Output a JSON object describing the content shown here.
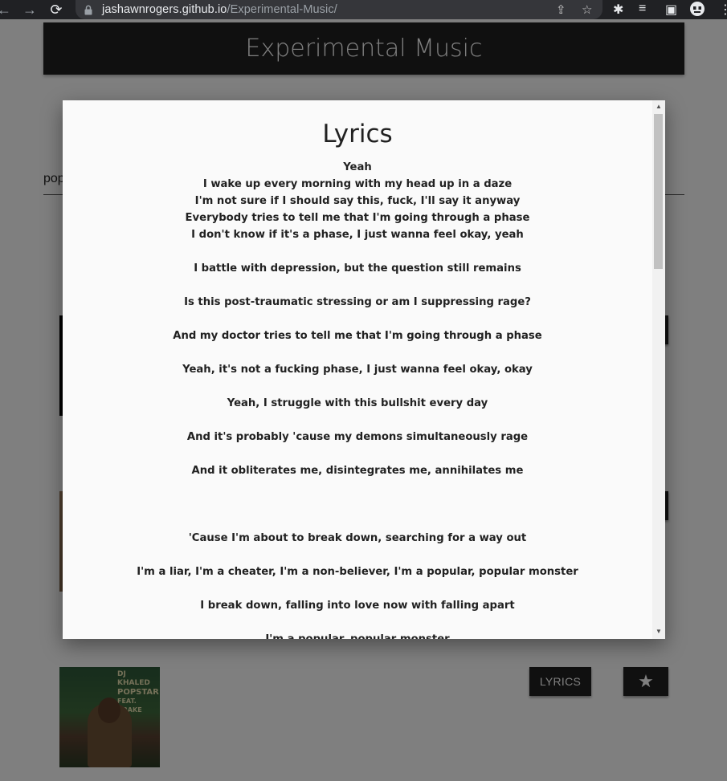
{
  "browser": {
    "url_host": "jashawnrogers.github.io",
    "url_path": "/Experimental-Music/"
  },
  "site": {
    "title": "Experimental Music",
    "search_value": "pop"
  },
  "tracks": [
    {
      "album_colors": [
        "#000000"
      ]
    },
    {
      "album_colors": [
        "#8b6b4f"
      ]
    },
    {
      "album_caption_line1": "DJ KHALED",
      "album_caption_line2": "POPSTAR",
      "album_caption_line3": "FEAT. DRAKE"
    }
  ],
  "buttons": {
    "lyrics_label": "LYRICS",
    "star_glyph": "★"
  },
  "modal": {
    "title": "Lyrics",
    "lines": [
      "Yeah",
      "I wake up every morning with my head up in a daze",
      "I'm not sure if I should say this, fuck, I'll say it anyway",
      "Everybody tries to tell me that I'm going through a phase",
      "I don't know if it's a phase, I just wanna feel okay, yeah",
      "",
      "I battle with depression, but the question still remains",
      "",
      "Is this post-traumatic stressing or am I suppressing rage?",
      "",
      "And my doctor tries to tell me that I'm going through a phase",
      "",
      "Yeah, it's not a fucking phase, I just wanna feel okay, okay",
      "",
      "Yeah, I struggle with this bullshit every day",
      "",
      "And it's probably 'cause my demons simultaneously rage",
      "",
      "And it obliterates me, disintegrates me, annihilates me",
      "",
      "",
      "",
      "'Cause I'm about to break down, searching for a way out",
      "",
      "I'm a liar, I'm a cheater, I'm a non-believer, I'm a popular, popular monster",
      "",
      "I break down, falling into love now with falling apart",
      "",
      "I'm a popular, popular monster"
    ]
  },
  "colors": {
    "header_bg": "#212121",
    "modal_bg": "#fafafa",
    "overlay": "rgba(0,0,0,0.5)"
  }
}
